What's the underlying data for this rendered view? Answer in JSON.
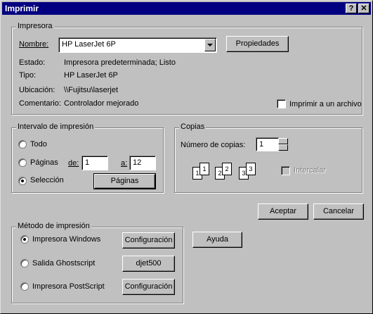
{
  "window": {
    "title": "Imprimir",
    "help_btn": "?",
    "close_btn": "✕"
  },
  "printer": {
    "group_label": "Impresora",
    "name_label": "Nombre:",
    "name_value": "HP LaserJet 6P",
    "properties_btn": "Propiedades",
    "status_label": "Estado:",
    "status_value": "Impresora predeterminada; Listo",
    "type_label": "Tipo:",
    "type_value": "HP LaserJet 6P",
    "location_label": "Ubicación:",
    "location_value": "\\\\Fujitsu\\laserjet",
    "comment_label": "Comentario:",
    "comment_value": "Controlador mejorado",
    "print_to_file": "Imprimir a un archivo",
    "print_to_file_checked": false
  },
  "range": {
    "group_label": "Intervalo de impresión",
    "all": "Todo",
    "pages": "Páginas",
    "from_label": "de:",
    "from_value": "1",
    "to_label": "a:",
    "to_value": "12",
    "selection": "Selección",
    "selected": "Selección",
    "pages_btn": "Páginas"
  },
  "copies": {
    "group_label": "Copias",
    "num_label": "Número de copias:",
    "num_value": "1",
    "collate": "Intercalar",
    "collate_enabled": false,
    "icon_labels": [
      "1",
      "1",
      "2",
      "2",
      "3",
      "3"
    ]
  },
  "buttons": {
    "ok": "Aceptar",
    "cancel": "Cancelar",
    "help": "Ayuda"
  },
  "method": {
    "group_label": "Método de impresión",
    "windows": "Impresora Windows",
    "windows_btn": "Configuración",
    "ghostscript": "Salida Ghostscript",
    "ghostscript_btn": "djet500",
    "postscript": "Impresora PostScript",
    "postscript_btn": "Configuración",
    "selected": "Impresora Windows"
  }
}
